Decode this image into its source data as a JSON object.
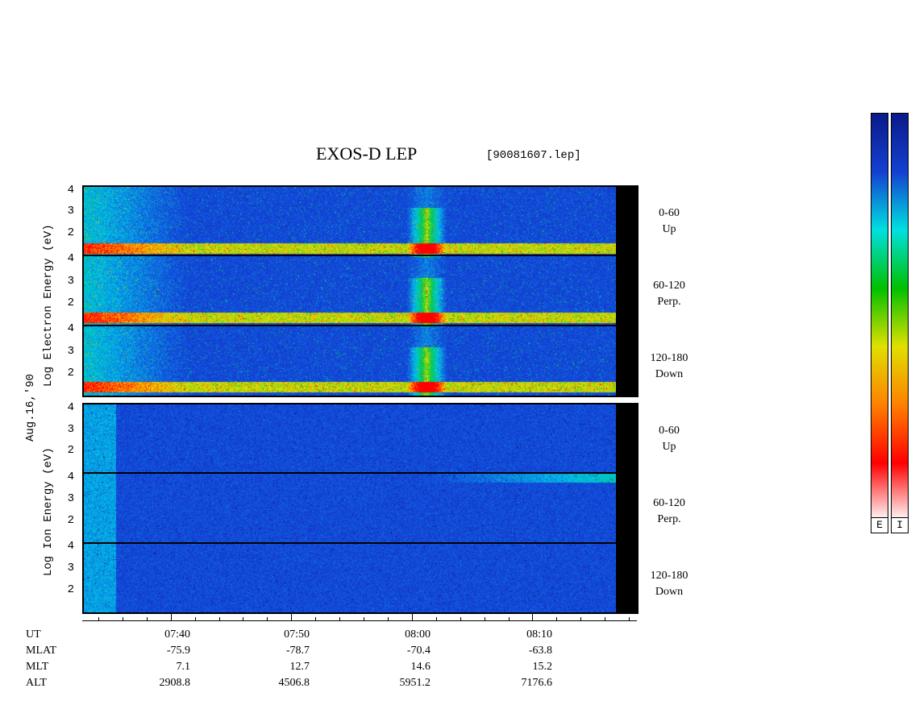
{
  "title": "EXOS-D LEP",
  "file": "[90081607.lep]",
  "date_label": "Aug.16,'90",
  "colors": {
    "background": "#0c1c9e",
    "strip": "#000000"
  },
  "chart_data": {
    "type": "heatmap",
    "y_tick_labels": [
      "4",
      "3",
      "2"
    ],
    "electron": {
      "ylabel": "Log Electron Energy (eV)",
      "channels": [
        {
          "range": "0-60",
          "direction": "Up"
        },
        {
          "range": "60-120",
          "direction": "Perp."
        },
        {
          "range": "120-180",
          "direction": "Down"
        }
      ]
    },
    "ion": {
      "ylabel": "Log Ion Energy (eV)",
      "channels": [
        {
          "range": "0-60",
          "direction": "Up"
        },
        {
          "range": "60-120",
          "direction": "Perp."
        },
        {
          "range": "120-180",
          "direction": "Down"
        }
      ]
    },
    "colorbar": {
      "labels": [
        "E",
        "I"
      ],
      "colors": [
        "#0a1a8a",
        "#1440d0",
        "#00e0e0",
        "#00c000",
        "#e0e000",
        "#ff8000",
        "#ff0000",
        "#ffffff"
      ]
    },
    "x_axis": {
      "row_labels": [
        "UT",
        "MLAT",
        "MLT",
        "ALT"
      ],
      "columns": [
        {
          "UT": "07:40",
          "MLAT": "-75.9",
          "MLT": "7.1",
          "ALT": "2908.8"
        },
        {
          "UT": "07:50",
          "MLAT": "-78.7",
          "MLT": "12.7",
          "ALT": "4506.8"
        },
        {
          "UT": "08:00",
          "MLAT": "-70.4",
          "MLT": "14.6",
          "ALT": "5951.2"
        },
        {
          "UT": "08:10",
          "MLAT": "-63.8",
          "MLT": "15.2",
          "ALT": "7176.6"
        }
      ]
    }
  }
}
